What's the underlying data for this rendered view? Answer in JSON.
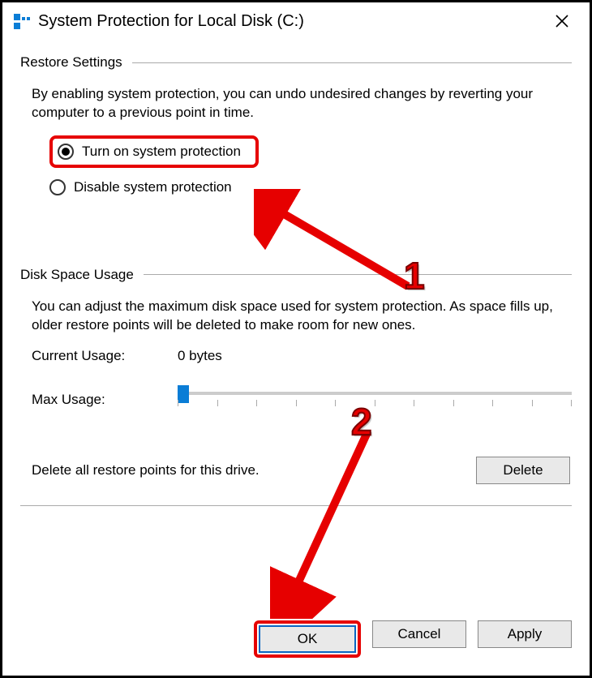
{
  "title": "System Protection for Local Disk (C:)",
  "sections": {
    "restore": {
      "header": "Restore Settings",
      "description": "By enabling system protection, you can undo undesired changes by reverting your computer to a previous point in time.",
      "options": {
        "on": "Turn on system protection",
        "off": "Disable system protection"
      }
    },
    "usage": {
      "header": "Disk Space Usage",
      "description": "You can adjust the maximum disk space used for system protection. As space fills up, older restore points will be deleted to make room for new ones.",
      "current_label": "Current Usage:",
      "current_value": "0 bytes",
      "max_label": "Max Usage:",
      "delete_text": "Delete all restore points for this drive.",
      "delete_button": "Delete"
    }
  },
  "buttons": {
    "ok": "OK",
    "cancel": "Cancel",
    "apply": "Apply"
  },
  "annotations": {
    "step1": "1",
    "step2": "2"
  }
}
